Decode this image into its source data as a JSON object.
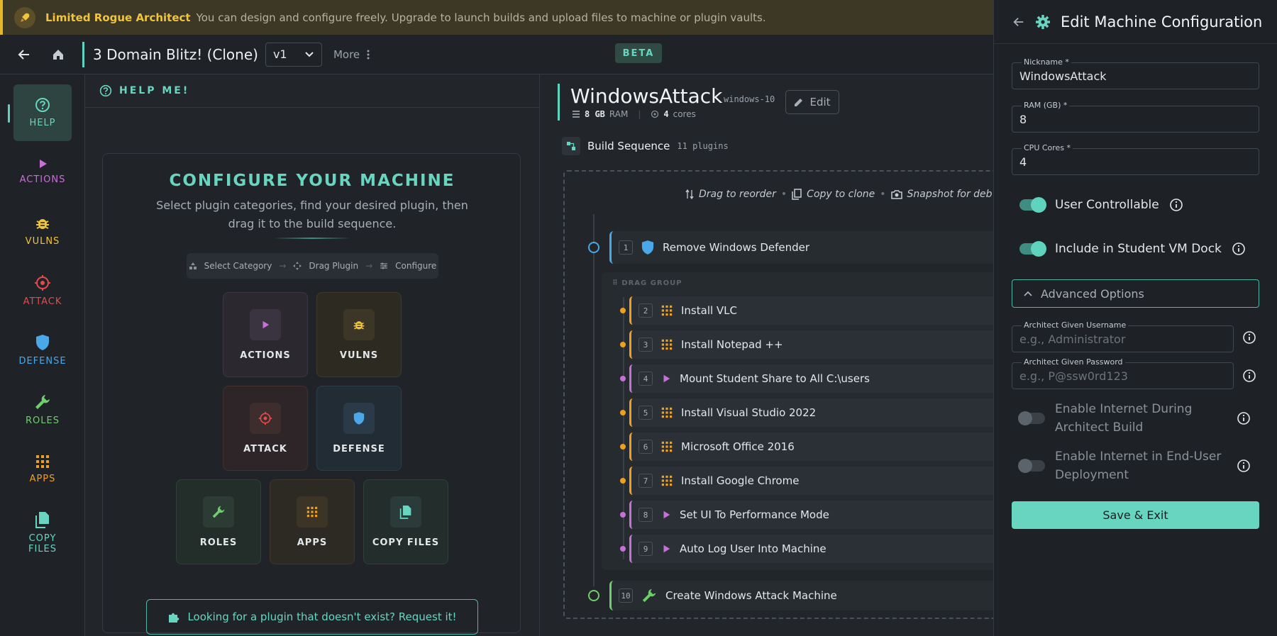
{
  "banner": {
    "title": "Limited Rogue Architect",
    "message": "You can design and configure freely. Upgrade to launch builds and upload files to machine or plugin vaults."
  },
  "topbar": {
    "project_name": "3 Domain Blitz! (Clone)",
    "version": "v1",
    "more_label": "More",
    "beta_label": "BETA"
  },
  "sidebar": {
    "items": [
      {
        "label": "HELP",
        "color": "#67d5c0",
        "icon": "help-circle-icon"
      },
      {
        "label": "ACTIONS",
        "color": "#c770d8",
        "icon": "play-icon"
      },
      {
        "label": "VULNS",
        "color": "#f0c43c",
        "icon": "bug-icon"
      },
      {
        "label": "ATTACK",
        "color": "#e34b4b",
        "icon": "crosshair-icon"
      },
      {
        "label": "DEFENSE",
        "color": "#4aa8e8",
        "icon": "shield-icon"
      },
      {
        "label": "ROLES",
        "color": "#6fcf6b",
        "icon": "wrench-icon"
      },
      {
        "label": "APPS",
        "color": "#f0a020",
        "icon": "grid-icon"
      },
      {
        "label": "COPY\nFILES",
        "color": "#67d5c0",
        "icon": "files-icon"
      }
    ]
  },
  "help": {
    "header": "HELP ME!",
    "title": "CONFIGURE YOUR MACHINE",
    "subtitle": "Select plugin categories, find your desired plugin, then drag it to the build sequence.",
    "steps": [
      "Select Category",
      "Drag Plugin",
      "Configure"
    ],
    "tiles": [
      {
        "label": "ACTIONS",
        "icon": "play-icon"
      },
      {
        "label": "VULNS",
        "icon": "bug-icon"
      },
      {
        "label": "ATTACK",
        "icon": "crosshair-icon"
      },
      {
        "label": "DEFENSE",
        "icon": "shield-icon"
      },
      {
        "label": "ROLES",
        "icon": "wrench-icon"
      },
      {
        "label": "APPS",
        "icon": "grid-icon"
      },
      {
        "label": "COPY FILES",
        "icon": "files-icon"
      }
    ],
    "request_label": "Looking for a plugin that doesn't exist? Request it!"
  },
  "machine": {
    "name": "WindowsAttack",
    "os": "windows-10",
    "edit_label": "Edit",
    "ram": "8 GB",
    "ram_label": "RAM",
    "cores": "4",
    "cores_label": "cores",
    "build_sequence_label": "Build Sequence",
    "plugin_count": "11 plugins",
    "hints": [
      "Drag to reorder",
      "Copy to clone",
      "Snapshot for deb"
    ],
    "drag_group_label": "DRAG GROUP",
    "steps": [
      {
        "num": "1",
        "name": "Remove Windows Defender",
        "type": "defense"
      },
      {
        "num": "2",
        "name": "Install VLC",
        "type": "app"
      },
      {
        "num": "3",
        "name": "Install Notepad ++",
        "type": "app"
      },
      {
        "num": "4",
        "name": "Mount Student Share to All C:\\users",
        "type": "action"
      },
      {
        "num": "5",
        "name": "Install Visual Studio 2022",
        "type": "app"
      },
      {
        "num": "6",
        "name": "Microsoft Office 2016",
        "type": "app"
      },
      {
        "num": "7",
        "name": "Install Google Chrome",
        "type": "app"
      },
      {
        "num": "8",
        "name": "Set UI To Performance Mode",
        "type": "action"
      },
      {
        "num": "9",
        "name": "Auto Log User Into Machine",
        "type": "action"
      },
      {
        "num": "10",
        "name": "Create Windows Attack Machine",
        "type": "role"
      }
    ]
  },
  "panel": {
    "title": "Edit Machine Configuration",
    "nickname_label": "Nickname *",
    "nickname_value": "WindowsAttack",
    "ram_label": "RAM (GB) *",
    "ram_value": "8",
    "cpu_label": "CPU Cores *",
    "cpu_value": "4",
    "user_controllable_label": "User Controllable",
    "user_controllable": true,
    "include_dock_label": "Include in Student VM Dock",
    "include_dock": true,
    "advanced_label": "Advanced Options",
    "username_label": "Architect Given Username",
    "username_placeholder": "e.g., Administrator",
    "password_label": "Architect Given Password",
    "password_placeholder": "e.g., P@ssw0rd123",
    "internet_build_label": "Enable Internet During Architect Build",
    "internet_build": false,
    "internet_deploy_label": "Enable Internet in End-User Deployment",
    "internet_deploy": false,
    "save_label": "Save & Exit"
  }
}
